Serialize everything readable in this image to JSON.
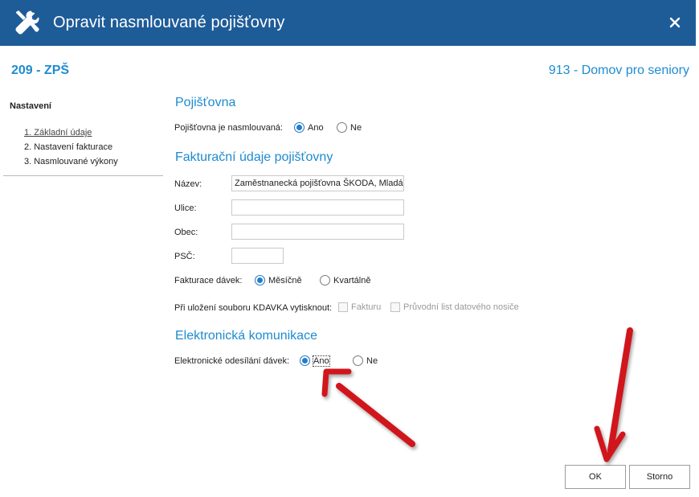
{
  "window": {
    "title": "Opravit nasmlouvané pojišťovny",
    "icon": "wrench-screwdriver-icon",
    "close_icon": "close-icon"
  },
  "header": {
    "left": "209 - ZPŠ",
    "right": "913 - Domov pro seniory"
  },
  "sidebar": {
    "title": "Nastavení",
    "items": [
      {
        "label": "1. Základní údaje",
        "active": true
      },
      {
        "label": "2. Nastavení fakturace",
        "active": false
      },
      {
        "label": "3. Nasmlouvané výkony",
        "active": false
      }
    ]
  },
  "insurer": {
    "heading": "Pojišťovna",
    "contracted_label": "Pojišťovna je nasmlouvaná:",
    "options": [
      "Ano",
      "Ne"
    ],
    "selected": "Ano"
  },
  "billing": {
    "heading": "Fakturační údaje pojišťovny",
    "name_label": "Název:",
    "name_value": "Zaměstnanecká pojišťovna ŠKODA, Mladá B",
    "street_label": "Ulice:",
    "street_value": "",
    "city_label": "Obec:",
    "city_value": "",
    "zip_label": "PSČ:",
    "zip_value": "",
    "batch_label": "Fakturace dávek:",
    "batch_options": [
      "Měsíčně",
      "Kvartálně"
    ],
    "batch_selected": "Měsíčně",
    "print_label": "Při uložení souboru KDAVKA vytisknout:",
    "print_options": [
      {
        "label": "Fakturu",
        "checked": false,
        "enabled": false
      },
      {
        "label": "Průvodní list datového nosiče",
        "checked": false,
        "enabled": false
      }
    ]
  },
  "ecomm": {
    "heading": "Elektronická komunikace",
    "send_label": "Elektronické odesílání dávek:",
    "options": [
      "Ano",
      "Ne"
    ],
    "selected": "Ano"
  },
  "buttons": {
    "ok": "OK",
    "cancel": "Storno"
  },
  "colors": {
    "titlebar": "#1e5c98",
    "accent": "#1e8bd0",
    "annotation_arrow": "#d0161b"
  }
}
